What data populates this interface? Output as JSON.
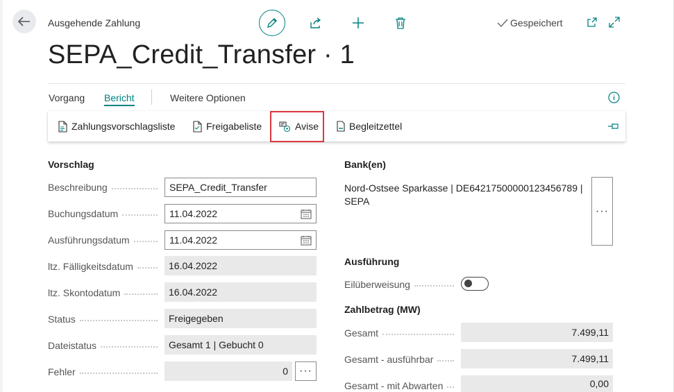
{
  "header": {
    "caption": "Ausgehende Zahlung",
    "title": "SEPA_Credit_Transfer · 1",
    "saved_label": "Gespeichert"
  },
  "tabs": [
    {
      "label": "Vorgang",
      "active": false
    },
    {
      "label": "Bericht",
      "active": true
    },
    {
      "label": "Weitere Optionen",
      "active": false
    }
  ],
  "toolbar": {
    "items": [
      {
        "label": "Zahlungsvorschlagsliste"
      },
      {
        "label": "Freigabeliste"
      },
      {
        "label": "Avise"
      },
      {
        "label": "Begleitzettel"
      }
    ]
  },
  "vorschlag": {
    "title": "Vorschlag",
    "fields": [
      {
        "label": "Beschreibung",
        "value": "SEPA_Credit_Transfer"
      },
      {
        "label": "Buchungsdatum",
        "value": "11.04.2022"
      },
      {
        "label": "Ausführungsdatum",
        "value": "11.04.2022"
      },
      {
        "label": "ltz. Fälligkeitsdatum",
        "value": "16.04.2022"
      },
      {
        "label": "ltz. Skontodatum",
        "value": "16.04.2022"
      },
      {
        "label": "Status",
        "value": "Freigegeben"
      },
      {
        "label": "Dateistatus",
        "value": "Gesamt 1 | Gebucht 0"
      },
      {
        "label": "Fehler",
        "value": "0"
      }
    ]
  },
  "bank": {
    "title": "Bank(en)",
    "line1": "Nord-Ostsee Sparkasse | DE64217500000123456789 |",
    "line2": "SEPA"
  },
  "ausfuehrung": {
    "title": "Ausführung",
    "eil_label": "Eilüberweisung",
    "eil_on": false
  },
  "zahlbetrag": {
    "title": "Zahlbetrag (MW)",
    "fields": [
      {
        "label": "Gesamt",
        "value": "7.499,11"
      },
      {
        "label": "Gesamt - ausführbar",
        "value": "7.499,11"
      },
      {
        "label": "Gesamt - mit Abwarten",
        "value": "0,00"
      }
    ]
  },
  "colors": {
    "accent": "#008080",
    "highlight": "#d9363e"
  }
}
